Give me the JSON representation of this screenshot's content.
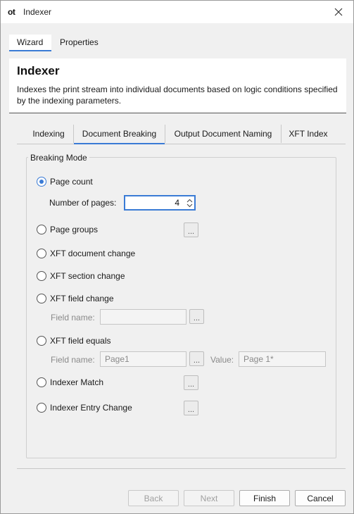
{
  "window": {
    "logo": "ot",
    "title": "Indexer"
  },
  "top_tabs": [
    {
      "label": "Wizard",
      "active": true
    },
    {
      "label": "Properties",
      "active": false
    }
  ],
  "header": {
    "title": "Indexer",
    "description": "Indexes the print stream into individual documents based on logic conditions specified by the indexing parameters."
  },
  "sub_tabs": [
    {
      "label": "Indexing",
      "active": false
    },
    {
      "label": "Document Breaking",
      "active": true
    },
    {
      "label": "Output Document Naming",
      "active": false
    },
    {
      "label": "XFT Index",
      "active": false
    }
  ],
  "breaking_mode": {
    "group_label": "Breaking Mode",
    "page_count_label": "Page count",
    "number_of_pages_label": "Number of pages:",
    "number_of_pages_value": "4",
    "page_groups_label": "Page groups",
    "xft_document_change_label": "XFT document change",
    "xft_section_change_label": "XFT section change",
    "xft_field_change_label": "XFT field change",
    "field_change_field_name_label": "Field name:",
    "field_change_field_name_value": "",
    "xft_field_equals_label": "XFT field equals",
    "field_equals_field_name_label": "Field name:",
    "field_equals_field_name_value": "Page1",
    "field_equals_value_label": "Value:",
    "field_equals_value_value": "Page 1*",
    "indexer_match_label": "Indexer Match",
    "indexer_entry_change_label": "Indexer Entry Change",
    "ellipsis": "..."
  },
  "buttons": {
    "back": "Back",
    "next": "Next",
    "finish": "Finish",
    "cancel": "Cancel"
  },
  "colors": {
    "accent": "#3a7bd5",
    "window_bg": "#f0f0f0"
  }
}
